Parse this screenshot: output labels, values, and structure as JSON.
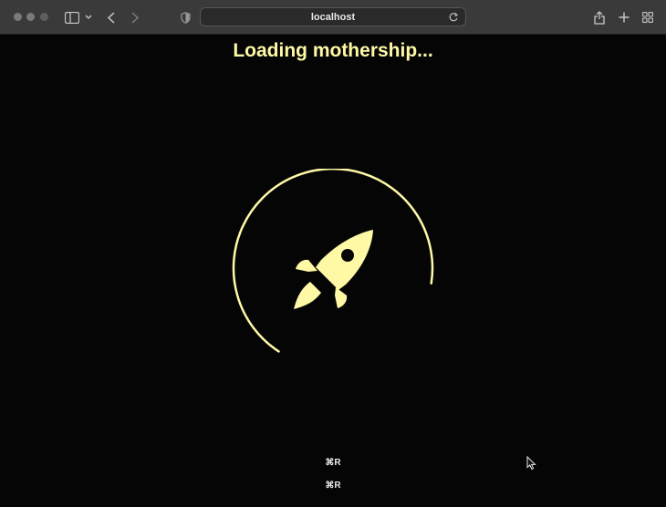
{
  "browser": {
    "url": "localhost"
  },
  "page": {
    "title": "Loading mothership...",
    "shortcut_1": "⌘R",
    "shortcut_2": "⌘R"
  },
  "theme": {
    "accent": "#fff9a6",
    "background": "#050505",
    "toolbar": "#3a3a3a"
  }
}
